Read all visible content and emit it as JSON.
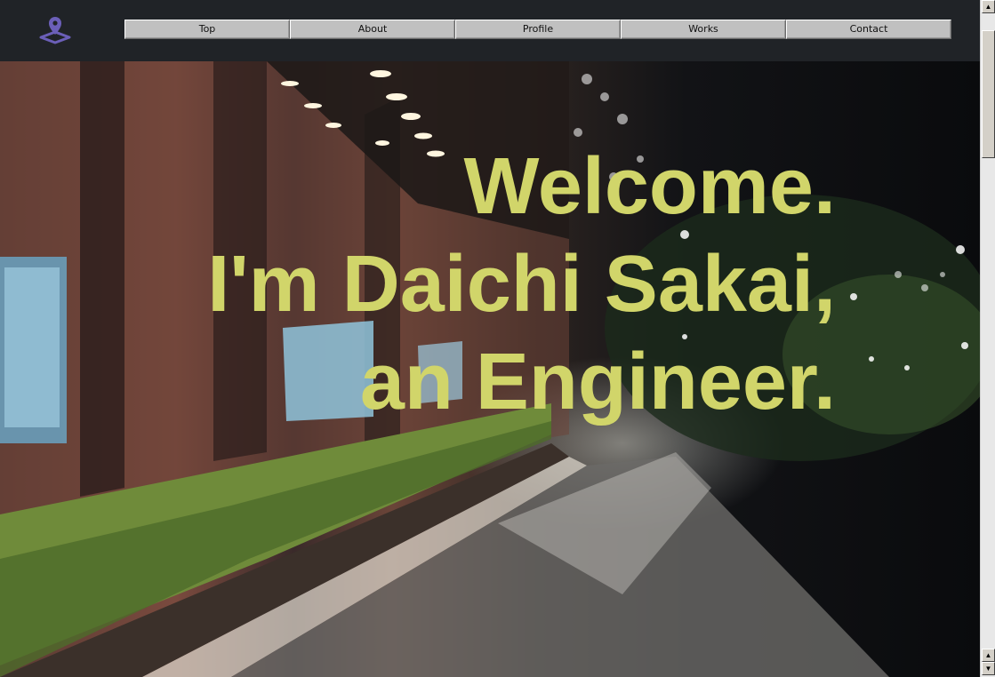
{
  "nav": {
    "items": [
      {
        "label": "Top"
      },
      {
        "label": "About"
      },
      {
        "label": "Profile"
      },
      {
        "label": "Works"
      },
      {
        "label": "Contact"
      }
    ]
  },
  "hero": {
    "line1": "Welcome.",
    "line2": "I'm Daichi Sakai,",
    "line3": "an Engineer."
  },
  "icons": {
    "logo": "map-pin-icon",
    "scroll_up": "arrow-up-icon",
    "scroll_down": "arrow-down-icon"
  },
  "colors": {
    "header_bg": "#202327",
    "headline": "#d1d56a",
    "logo": "#6b5fb8",
    "nav_button": "#c0c0c0"
  }
}
